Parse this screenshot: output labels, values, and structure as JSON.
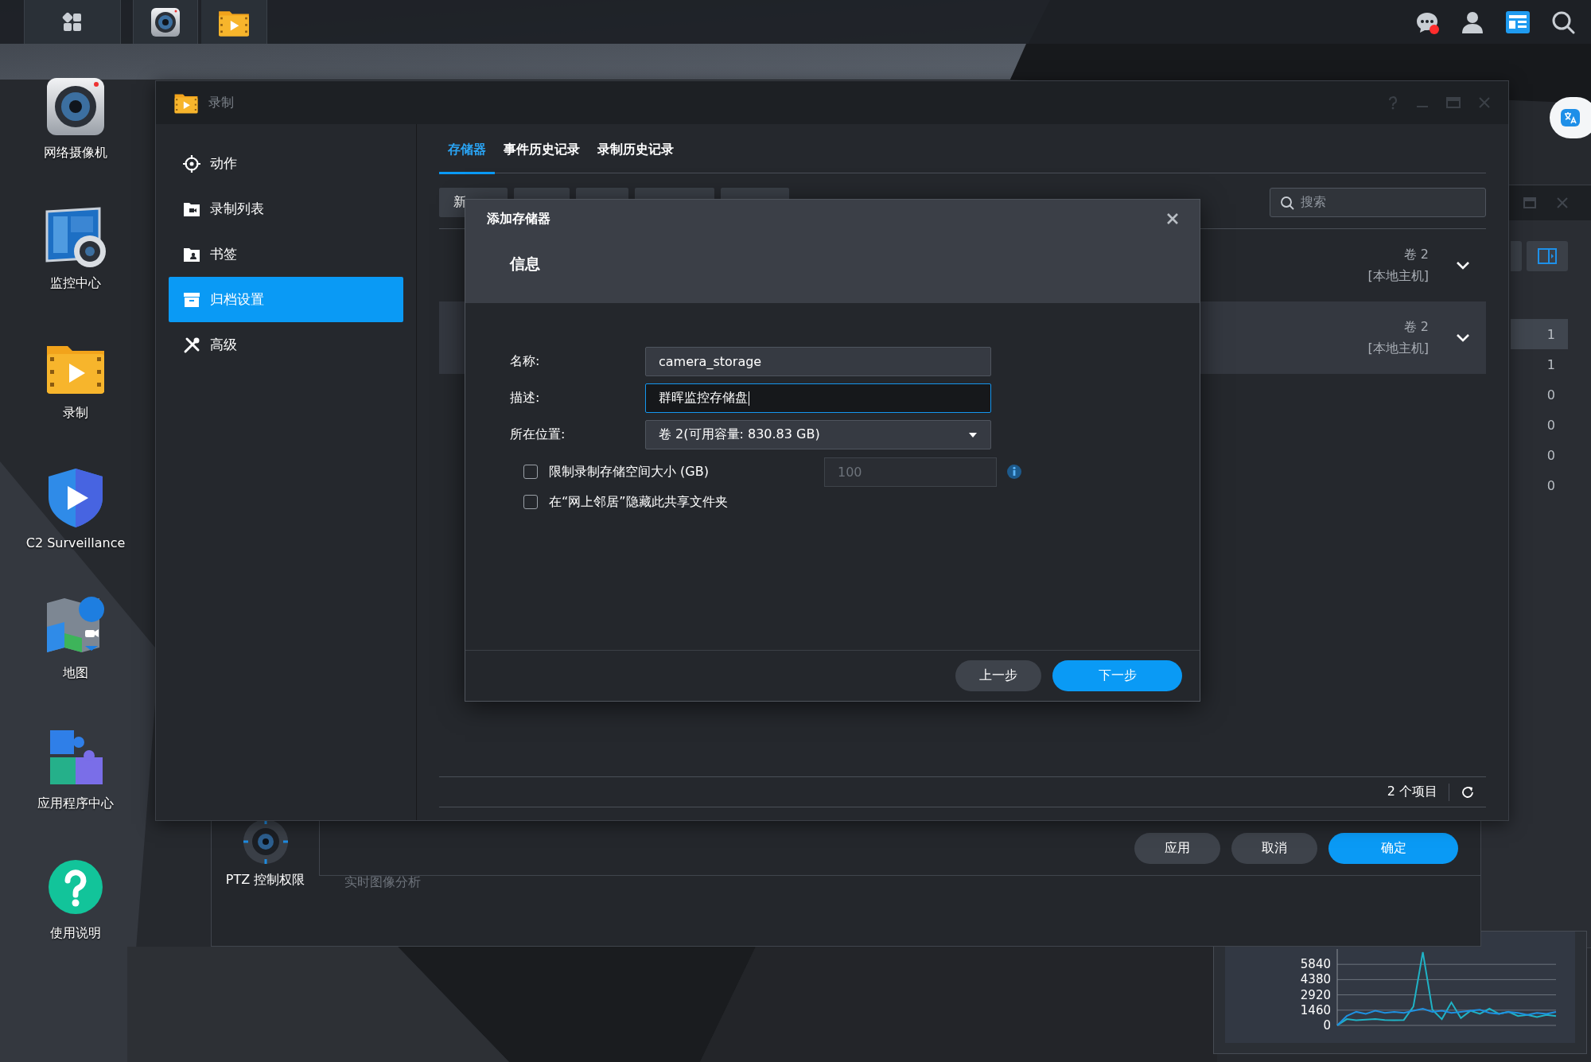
{
  "desktop_icons": [
    {
      "kind": "camera",
      "label": "网络摄像机"
    },
    {
      "kind": "monitor",
      "label": "监控中心"
    },
    {
      "kind": "recording",
      "label": "录制"
    },
    {
      "kind": "shield",
      "label": "C2 Surveillance"
    },
    {
      "kind": "map",
      "label": "地图"
    },
    {
      "kind": "puzzle",
      "label": "应用程序中心"
    },
    {
      "kind": "help",
      "label": "使用说明"
    }
  ],
  "window": {
    "title": "录制",
    "sidebar": [
      {
        "kind": "target",
        "label": "动作",
        "selected": false
      },
      {
        "kind": "video-folder",
        "label": "录制列表",
        "selected": false
      },
      {
        "kind": "person-folder",
        "label": "书签",
        "selected": false
      },
      {
        "kind": "archive",
        "label": "归档设置",
        "selected": true
      },
      {
        "kind": "tools",
        "label": "高级",
        "selected": false
      }
    ],
    "tabs": [
      {
        "label": "存储器",
        "selected": true
      },
      {
        "label": "事件历史记录",
        "selected": false
      },
      {
        "label": "录制历史记录",
        "selected": false
      }
    ],
    "toolbar_button": "新",
    "search": {
      "placeholder": "搜索"
    },
    "rows": [
      {
        "volume": "卷 2",
        "host": "[本地主机]",
        "selected": false
      },
      {
        "volume": "卷 2",
        "host": "[本地主机]",
        "selected": true
      }
    ],
    "item_count": "2 个项目"
  },
  "dialog": {
    "title": "添加存储器",
    "section": "信息",
    "fields": [
      {
        "kind": "text",
        "label": "名称:",
        "value": "camera_storage",
        "focused": false
      },
      {
        "kind": "text",
        "label": "描述:",
        "value": "群晖监控存储盘",
        "focused": true
      },
      {
        "kind": "select",
        "label": "所在位置:",
        "value": "卷 2(可用容量: 830.83 GB)",
        "focused": false
      }
    ],
    "options": [
      {
        "label": "限制录制存储空间大小 (GB)",
        "checked": false,
        "input": {
          "placeholder": "100",
          "disabled": true
        }
      },
      {
        "label": "在“网上邻居”隐藏此共享文件夹",
        "checked": false
      }
    ],
    "buttons": [
      {
        "label": "上一步",
        "primary": false
      },
      {
        "label": "下一步",
        "primary": true
      }
    ]
  },
  "back_window": {
    "items": [
      {
        "label": "PTZ 控制权限",
        "disabled": false
      },
      {
        "label": "实时图像分析",
        "disabled": true
      }
    ],
    "buttons": [
      {
        "label": "应用",
        "primary": false
      },
      {
        "label": "取消",
        "primary": false
      },
      {
        "label": "确定",
        "primary": true
      }
    ]
  },
  "right_window": {
    "values": [
      {
        "text": "1",
        "selected": true
      },
      {
        "text": "1",
        "selected": false
      },
      {
        "text": "0",
        "selected": false
      },
      {
        "text": "0",
        "selected": false
      },
      {
        "text": "0",
        "selected": false
      },
      {
        "text": "0",
        "selected": false
      }
    ]
  },
  "chart_widget": {
    "chart_data": {
      "type": "line",
      "grid": true,
      "ylim": [
        0,
        7300
      ],
      "yticks": [
        0,
        1460,
        2920,
        4380,
        5840
      ],
      "series": [
        {
          "color": "#1fb3c6",
          "values": [
            0,
            600,
            500,
            550,
            600,
            520,
            500,
            520,
            1800,
            7000,
            1500,
            600,
            2200,
            700,
            1400,
            1100,
            1600,
            1100,
            1300,
            900,
            1000,
            800,
            1000,
            900
          ]
        },
        {
          "color": "#1e90e0",
          "values": [
            0,
            900,
            1300,
            1100,
            1400,
            1200,
            1300,
            1200,
            1400,
            1600,
            1300,
            1400,
            1200,
            1300,
            1400,
            1500,
            1200,
            1100,
            1300,
            1200,
            1000,
            1200,
            1100,
            1300
          ]
        }
      ]
    }
  }
}
